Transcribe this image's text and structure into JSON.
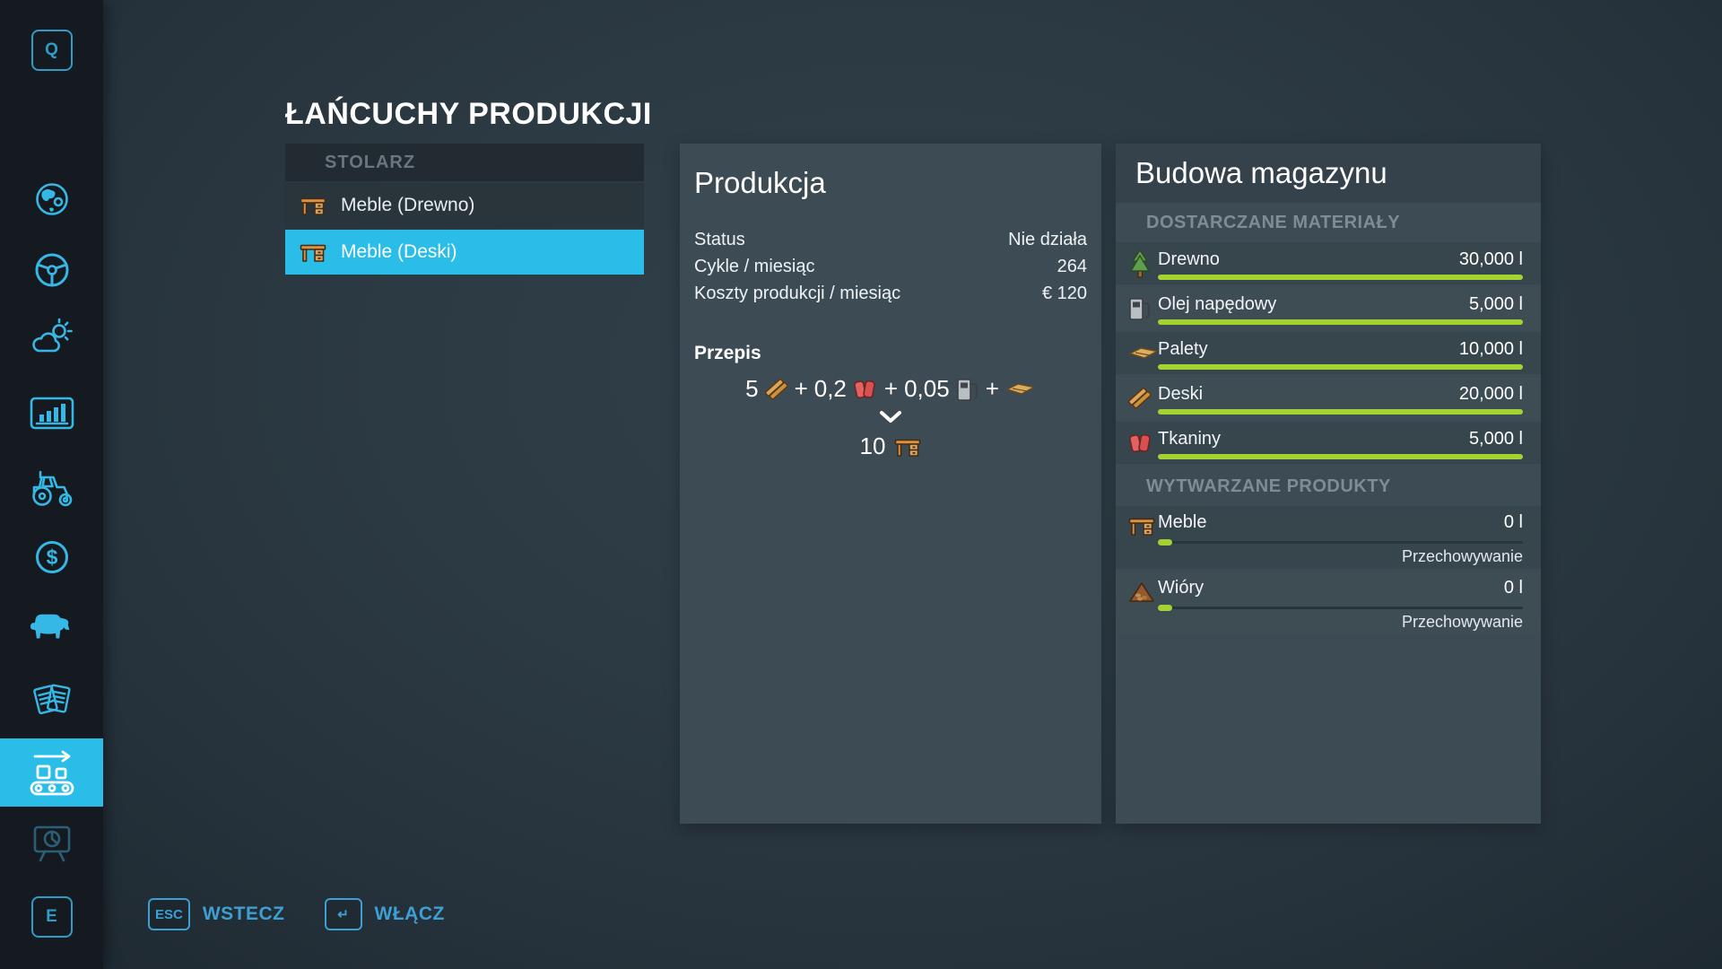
{
  "colors": {
    "accent_cyan": "#2abde8",
    "bar_green": "#a4d233",
    "footer_blue": "#3d9fd3",
    "sidebar_bg": "#151a20",
    "panel_bg": "#3d4c54"
  },
  "page_title": "ŁAŃCUCHY PRODUKCJI",
  "sidebar": {
    "hotkey_top": "Q",
    "hotkey_bottom": "E",
    "icons": [
      "globe-icon",
      "steering-wheel-icon",
      "weather-icon",
      "statistics-icon",
      "tractor-icon",
      "finances-icon",
      "animals-icon",
      "contracts-icon",
      "production-chains-icon",
      "presentation-icon"
    ],
    "selected_item": "production-chains-icon"
  },
  "chain_list": {
    "group_label": "STOLARZ",
    "items": [
      {
        "label": "Meble (Drewno)",
        "selected": false
      },
      {
        "label": "Meble (Deski)",
        "selected": true
      }
    ]
  },
  "production_panel": {
    "title": "Produkcja",
    "rows": [
      {
        "label": "Status",
        "value": "Nie działa"
      },
      {
        "label": "Cykle / miesiąc",
        "value": "264"
      },
      {
        "label": "Koszty produkcji / miesiąc",
        "value": "€ 120"
      }
    ],
    "recipe": {
      "heading": "Przepis",
      "plus": "+",
      "inputs": [
        {
          "qty": "5",
          "icon": "planks-icon"
        },
        {
          "qty": "0,2",
          "icon": "fabric-icon"
        },
        {
          "qty": "0,05",
          "icon": "fuel-icon"
        },
        {
          "qty": "",
          "icon": "pallet-icon"
        }
      ],
      "output_qty": "10",
      "output_icon": "furniture-icon"
    }
  },
  "storage_panel": {
    "title": "Budowa magazynu",
    "materials_header": "DOSTARCZANE MATERIAŁY",
    "materials": [
      {
        "name": "Drewno",
        "amount": "30,000 l",
        "fill": "100%",
        "icon": "tree-icon"
      },
      {
        "name": "Olej napędowy",
        "amount": "5,000 l",
        "fill": "100%",
        "icon": "fuel-icon"
      },
      {
        "name": "Palety",
        "amount": "10,000 l",
        "fill": "100%",
        "icon": "pallet-icon"
      },
      {
        "name": "Deski",
        "amount": "20,000 l",
        "fill": "100%",
        "icon": "planks-icon"
      },
      {
        "name": "Tkaniny",
        "amount": "5,000 l",
        "fill": "100%",
        "icon": "fabric-icon"
      }
    ],
    "products_header": "WYTWARZANE PRODUKTY",
    "products": [
      {
        "name": "Meble",
        "amount": "0 l",
        "fill": "4%",
        "mode": "Przechowywanie",
        "icon": "furniture-icon"
      },
      {
        "name": "Wióry",
        "amount": "0 l",
        "fill": "4%",
        "mode": "Przechowywanie",
        "icon": "woodchips-icon"
      }
    ]
  },
  "footer": {
    "back_key": "ESC",
    "back_label": "WSTECZ",
    "activate_key": "↵",
    "activate_label": "WŁĄCZ"
  }
}
